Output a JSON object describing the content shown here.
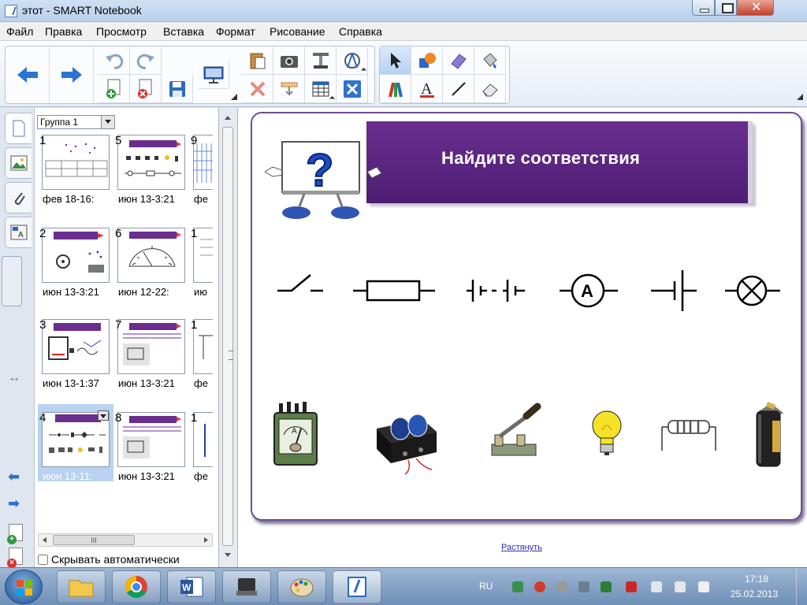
{
  "window": {
    "title": "этот - SMART Notebook"
  },
  "menu": [
    "Файл",
    "Правка",
    "Просмотр",
    "Вставка",
    "Формат",
    "Рисование",
    "Справка"
  ],
  "sorter": {
    "group": "Группа 1",
    "pages": [
      {
        "num": "1",
        "date": "фев  18-16:"
      },
      {
        "num": "5",
        "date": "июн  13-3:21"
      },
      {
        "num": "9",
        "date": "фе"
      },
      {
        "num": "2",
        "date": "июн  13-3:21"
      },
      {
        "num": "6",
        "date": "июн  12-22:"
      },
      {
        "num": "1",
        "date": "ию"
      },
      {
        "num": "3",
        "date": "июн  13-1:37"
      },
      {
        "num": "7",
        "date": "июн  13-3:21"
      },
      {
        "num": "1",
        "date": "фе"
      },
      {
        "num": "4",
        "date": "июн  13-11:"
      },
      {
        "num": "8",
        "date": "июн  13-3:21"
      },
      {
        "num": "1",
        "date": "фе"
      }
    ],
    "auto_hide": "Скрывать автоматически",
    "scroll_glyph": "III"
  },
  "slide": {
    "title": "Найдите  соответствия",
    "symbols": [
      "switch",
      "resistor",
      "battery",
      "ammeter",
      "cell",
      "lamp"
    ],
    "devices": [
      "ammeter-device",
      "battery-device",
      "knife-switch",
      "light-bulb",
      "resistor-device",
      "cell-device"
    ]
  },
  "canvas": {
    "stretch_link": "Растянуть"
  },
  "taskbar": {
    "lang": "RU",
    "time": "17:18",
    "date": "25.02.2013"
  },
  "colors": {
    "accent": "#6a2e8f",
    "titlebar": "#c6daf0"
  }
}
